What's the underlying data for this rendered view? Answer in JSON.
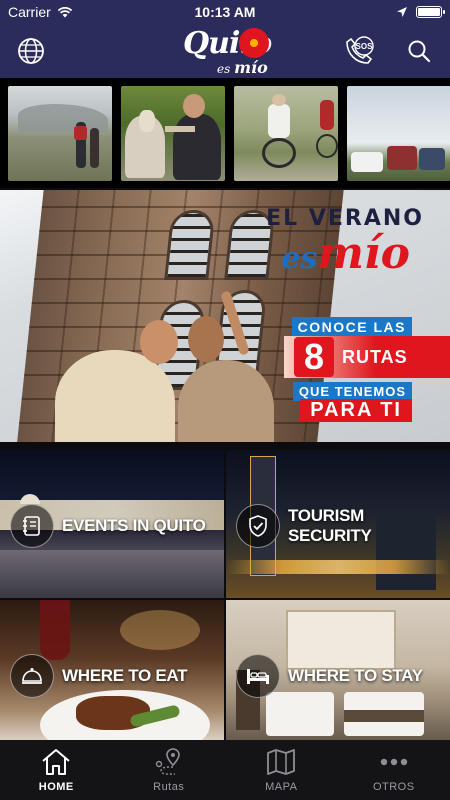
{
  "status_bar": {
    "carrier": "Carrier",
    "time": "10:13 AM"
  },
  "header": {
    "logo": {
      "main": "Quito",
      "sub_es": "es",
      "sub_mio": "mío"
    },
    "globe_icon": "globe-icon",
    "sos_icon": "sos-phone-icon",
    "sos_label": "SOS",
    "search_icon": "search-icon",
    "color": "#2b2c5c"
  },
  "photo_strip": {
    "thumbs": [
      {
        "name": "hikers"
      },
      {
        "name": "alpaca"
      },
      {
        "name": "cyclists"
      },
      {
        "name": "lookout"
      }
    ]
  },
  "banner": {
    "line1": "EL VERANO",
    "es": "es",
    "mio": "mío",
    "conoce": "CONOCE LAS",
    "number": "8",
    "rutas": "RUTAS",
    "tenemos": "QUE TENEMOS",
    "parati": "PARA TI"
  },
  "tiles": [
    {
      "label": "EVENTS IN QUITO",
      "icon": "notebook-icon"
    },
    {
      "label": "TOURISM SECURITY",
      "icon": "shield-check-icon"
    },
    {
      "label": "WHERE TO EAT",
      "icon": "cloche-icon"
    },
    {
      "label": "WHERE TO STAY",
      "icon": "bed-icon"
    }
  ],
  "tabbar": {
    "items": [
      {
        "label": "HOME",
        "icon": "home-icon",
        "active": true
      },
      {
        "label": "Rutas",
        "icon": "route-pin-icon",
        "active": false
      },
      {
        "label": "MAPA",
        "icon": "map-icon",
        "active": false
      },
      {
        "label": "OTROS",
        "icon": "more-dots-icon",
        "active": false
      }
    ]
  }
}
